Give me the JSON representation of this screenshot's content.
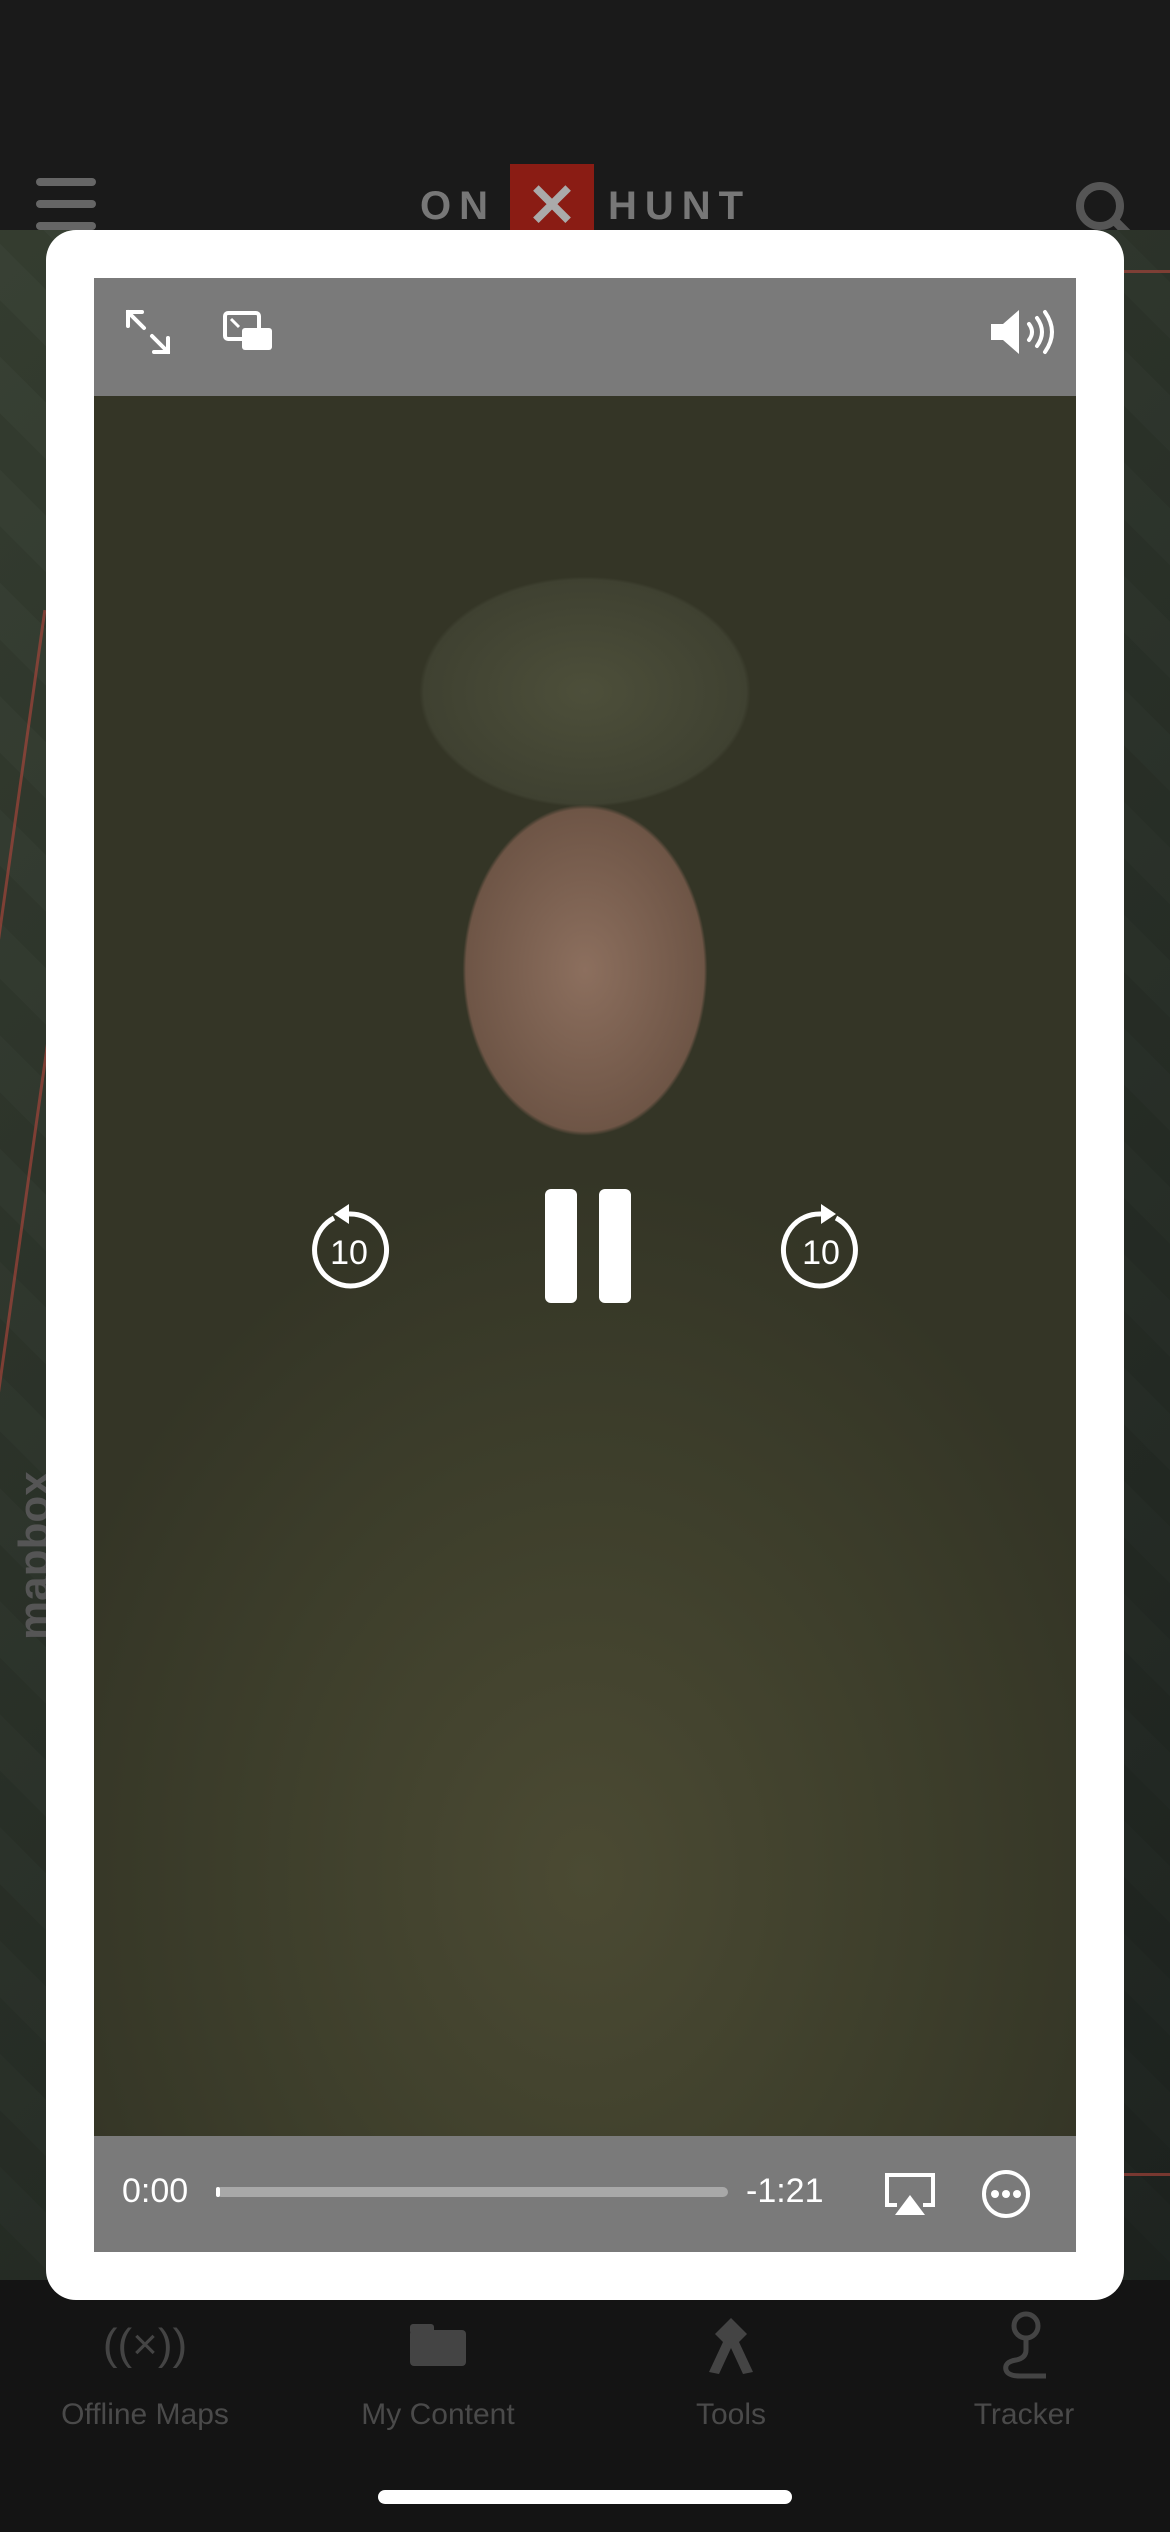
{
  "app": {
    "logo_left": "ON",
    "logo_mark": "✕",
    "logo_right": "HUNT",
    "mapbox": "mapbox"
  },
  "bottom_nav": [
    {
      "label": "Offline Maps",
      "icon": "offline-maps-icon"
    },
    {
      "label": "My Content",
      "icon": "my-content-icon"
    },
    {
      "label": "Tools",
      "icon": "tools-icon"
    },
    {
      "label": "Tracker",
      "icon": "tracker-icon"
    }
  ],
  "player": {
    "elapsed": "0:00",
    "remaining": "-1:21",
    "skip_back_seconds": "10",
    "skip_forward_seconds": "10",
    "progress": 0.0,
    "state": "playing"
  },
  "colors": {
    "accent": "#8a1c14",
    "modal_bg": "#ffffff",
    "controls_bar": "#7a7a7a"
  }
}
